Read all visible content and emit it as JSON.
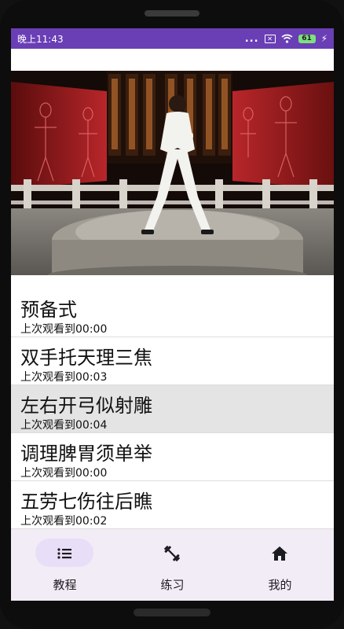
{
  "status_bar": {
    "time": "晚上11:43",
    "dots": "...",
    "sim_icon": "sim-card-x-icon",
    "wifi_icon": "wifi-icon",
    "battery_level": "61",
    "charging_icon": "lightning-icon"
  },
  "video": {
    "icon": "video-player-icon"
  },
  "lessons": [
    {
      "title": "预备式",
      "progress": "上次观看到00:00"
    },
    {
      "title": "双手托天理三焦",
      "progress": "上次观看到00:03"
    },
    {
      "title": "左右开弓似射雕",
      "progress": "上次观看到00:04"
    },
    {
      "title": "调理脾胃须单举",
      "progress": "上次观看到00:00"
    },
    {
      "title": "五劳七伤往后瞧",
      "progress": "上次观看到00:02"
    }
  ],
  "bottom_nav": {
    "items": [
      {
        "label": "教程",
        "icon": "list-icon",
        "active": true
      },
      {
        "label": "练习",
        "icon": "dumbbell-icon",
        "active": false
      },
      {
        "label": "我的",
        "icon": "home-icon",
        "active": false
      }
    ]
  },
  "colors": {
    "status_bar": "#6a3fb5",
    "nav_background": "#f2ecf6",
    "nav_active_pill": "#e8def7",
    "selected_row": "#e4e4e4"
  }
}
